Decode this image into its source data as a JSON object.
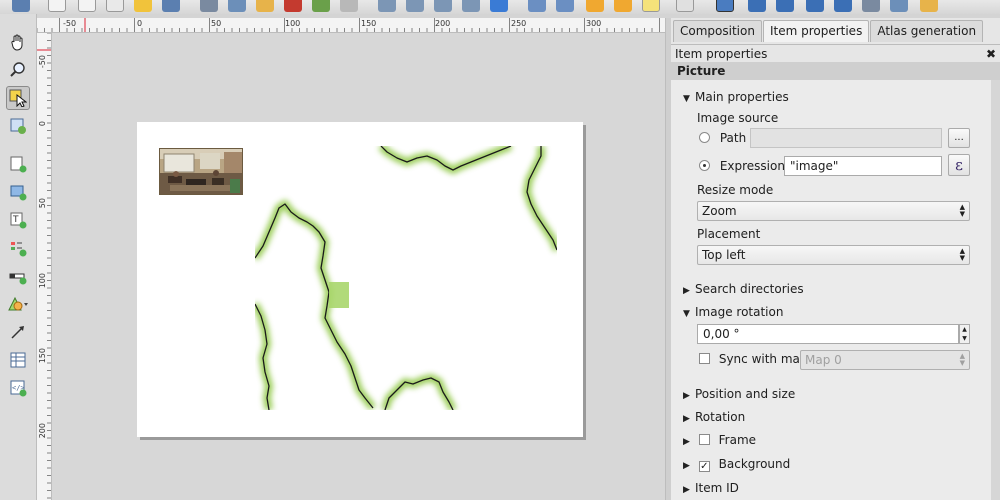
{
  "ruler": {
    "h_labels": [
      "-50",
      "0",
      "50",
      "100",
      "150",
      "200",
      "250",
      "300"
    ],
    "v_labels": [
      "-50",
      "0",
      "50",
      "100",
      "150",
      "200"
    ]
  },
  "panel": {
    "tabs": [
      {
        "label": "Composition"
      },
      {
        "label": "Item properties"
      },
      {
        "label": "Atlas generation"
      }
    ],
    "title": "Item properties",
    "close_glyph": "✖",
    "section": "Picture"
  },
  "props": {
    "main_properties": "Main properties",
    "image_source": "Image source",
    "path_label": "Path",
    "path_value": "",
    "browse_label": "...",
    "expression_label": "Expression",
    "expression_value": "\"image\"",
    "expression_button": "ε",
    "resize_mode_label": "Resize mode",
    "resize_mode_value": "Zoom",
    "placement_label": "Placement",
    "placement_value": "Top left",
    "search_directories": "Search directories",
    "image_rotation": "Image rotation",
    "rotation_value": "0,00 °",
    "sync_with_map": "Sync with map",
    "map_value": "Map 0",
    "position_and_size": "Position and size",
    "rotation": "Rotation",
    "frame": "Frame",
    "background": "Background",
    "item_id": "Item ID"
  },
  "state": {
    "path_selected": false,
    "expression_selected": true,
    "sync_checked": false,
    "frame_checked": false,
    "background_checked": true
  },
  "colors": {
    "accent_map": "#8cc63f",
    "map_border": "#1a1a1a"
  }
}
